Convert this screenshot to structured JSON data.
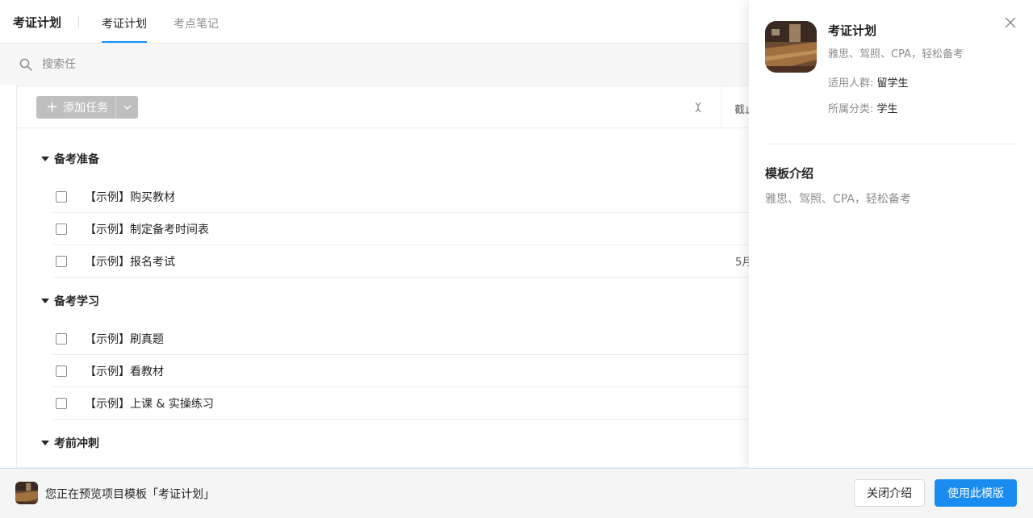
{
  "header": {
    "app_title": "考证计划",
    "tabs": [
      {
        "label": "考证计划",
        "active": true
      },
      {
        "label": "考点笔记",
        "active": false
      }
    ]
  },
  "search": {
    "placeholder": "搜索任"
  },
  "toolbar": {
    "add_task_label": "添加任务",
    "column_header": "截止"
  },
  "groups": [
    {
      "name": "备考准备",
      "tasks": [
        {
          "title": "【示例】购买教材",
          "date": ""
        },
        {
          "title": "【示例】制定备考时间表",
          "date": ""
        },
        {
          "title": "【示例】报名考试",
          "date": "5月"
        }
      ]
    },
    {
      "name": "备考学习",
      "tasks": [
        {
          "title": "【示例】刷真题",
          "date": ""
        },
        {
          "title": "【示例】看教材",
          "date": ""
        },
        {
          "title": "【示例】上课 & 实操练习",
          "date": ""
        }
      ]
    },
    {
      "name": "考前冲刺",
      "tasks": []
    }
  ],
  "panel": {
    "title": "考证计划",
    "subtitle": "雅思、驾照、CPA，轻松备考",
    "audience_label": "适用人群: ",
    "audience_value": "留学生",
    "category_label": "所属分类: ",
    "category_value": "学生",
    "intro_heading": "模板介绍",
    "intro_text": "雅思、驾照、CPA，轻松备考"
  },
  "footer": {
    "preview_text": "您正在预览项目模板「考证计划」",
    "close_intro_label": "关闭介绍",
    "use_template_label": "使用此模版"
  },
  "colors": {
    "accent": "#1890ff",
    "primary_button": "#1a8cf0",
    "disabled_button": "#bfbfbf"
  }
}
